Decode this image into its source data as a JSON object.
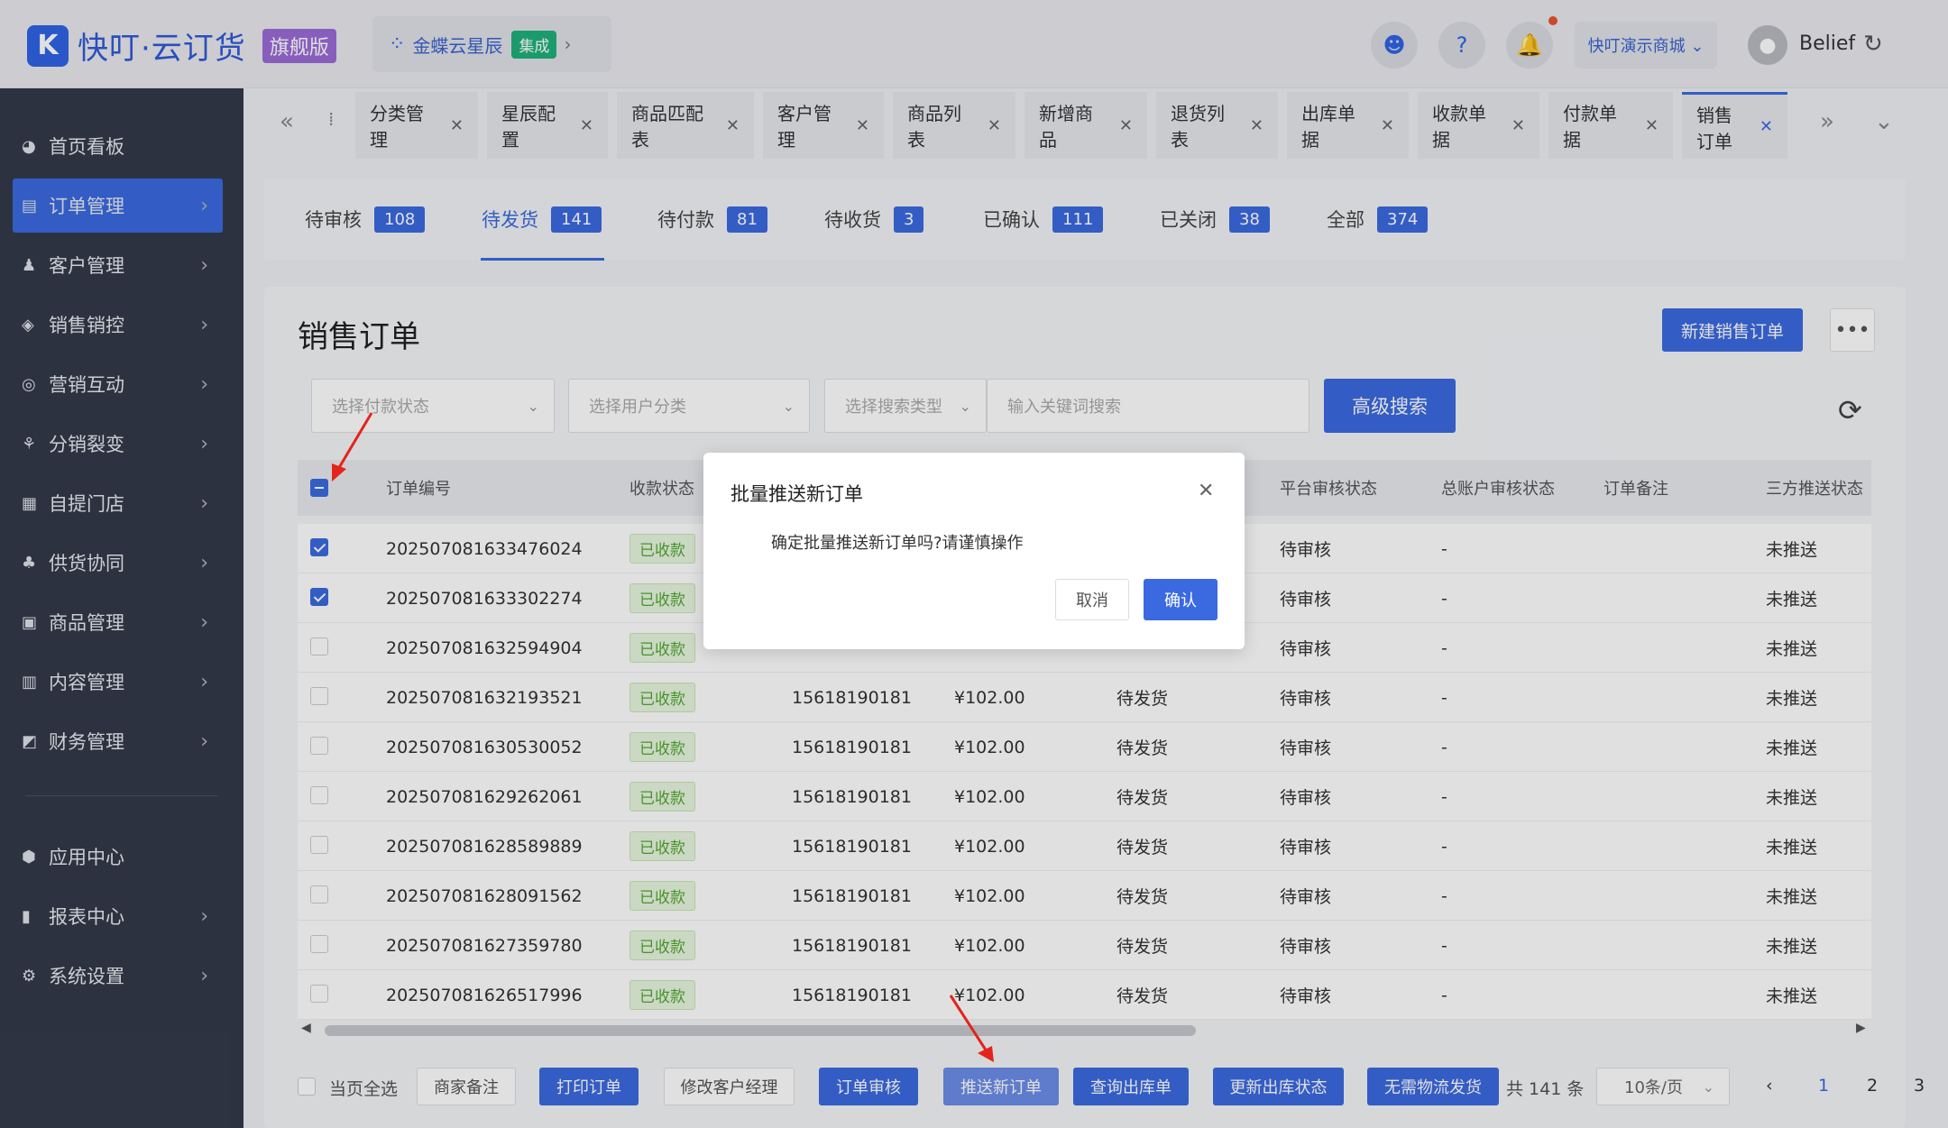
{
  "brand": {
    "logo_glyph": "K",
    "name": "快叮·云订货",
    "badge": "旗舰版"
  },
  "integration": {
    "dots": "⁘",
    "name": "金蝶云星辰",
    "badge": "集成",
    "chevron": "›"
  },
  "header": {
    "store": "快叮演示商城 ⌄",
    "user": "Belief",
    "refresh": "↻",
    "avatar": "●"
  },
  "top_icons": {
    "support": "☻",
    "help": "?",
    "bell": "🔔"
  },
  "sidebar": {
    "items": [
      {
        "icon": "◕",
        "label": "首页看板",
        "chevron": ""
      },
      {
        "icon": "▤",
        "label": "订单管理",
        "chevron": "›"
      },
      {
        "icon": "♟",
        "label": "客户管理",
        "chevron": "›"
      },
      {
        "icon": "◈",
        "label": "销售销控",
        "chevron": "›"
      },
      {
        "icon": "◎",
        "label": "营销互动",
        "chevron": "›"
      },
      {
        "icon": "⚘",
        "label": "分销裂变",
        "chevron": "›"
      },
      {
        "icon": "▦",
        "label": "自提门店",
        "chevron": "›"
      },
      {
        "icon": "♣",
        "label": "供货协同",
        "chevron": "›"
      },
      {
        "icon": "▣",
        "label": "商品管理",
        "chevron": "›"
      },
      {
        "icon": "▥",
        "label": "内容管理",
        "chevron": "›"
      },
      {
        "icon": "◩",
        "label": "财务管理",
        "chevron": "›"
      }
    ],
    "bottom_items": [
      {
        "icon": "⬢",
        "label": "应用中心",
        "chevron": ""
      },
      {
        "icon": "▮",
        "label": "报表中心",
        "chevron": "›"
      },
      {
        "icon": "⚙",
        "label": "系统设置",
        "chevron": "›"
      }
    ]
  },
  "tabs": {
    "prev": "«",
    "sep": "⁞",
    "next": "»",
    "menu": "⌄",
    "close": "✕",
    "items": [
      "分类管理",
      "星辰配置",
      "商品匹配表",
      "客户管理",
      "商品列表",
      "新增商品",
      "退货列表",
      "出库单据",
      "收款单据",
      "付款单据",
      "销售订单"
    ]
  },
  "status_tabs": [
    {
      "label": "待审核",
      "count": "108"
    },
    {
      "label": "待发货",
      "count": "141"
    },
    {
      "label": "待付款",
      "count": "81"
    },
    {
      "label": "待收货",
      "count": "3"
    },
    {
      "label": "已确认",
      "count": "111"
    },
    {
      "label": "已关闭",
      "count": "38"
    },
    {
      "label": "全部",
      "count": "374"
    }
  ],
  "page": {
    "title": "销售订单",
    "new_button": "新建销售订单",
    "more": "•••"
  },
  "filters": {
    "payment_status": "选择付款状态",
    "user_category": "选择用户分类",
    "search_type": "选择搜索类型",
    "keyword_placeholder": "输入关键词搜索",
    "advanced": "高级搜索",
    "chevron": "⌄",
    "refresh": "⟳"
  },
  "table": {
    "headers": [
      "订单编号",
      "收款状态",
      "平台审核状态",
      "总账户审核状态",
      "订单备注",
      "三方推送状态"
    ],
    "rows": [
      {
        "id": "202507081633476024",
        "pay": "已收款",
        "phone": "",
        "amount": "",
        "ship": "",
        "audit": "待审核",
        "acct": "-",
        "push": "未推送"
      },
      {
        "id": "202507081633302274",
        "pay": "已收款",
        "phone": "",
        "amount": "",
        "ship": "",
        "audit": "待审核",
        "acct": "-",
        "push": "未推送"
      },
      {
        "id": "202507081632594904",
        "pay": "已收款",
        "phone": "",
        "amount": "",
        "ship": "",
        "audit": "待审核",
        "acct": "-",
        "push": "未推送"
      },
      {
        "id": "202507081632193521",
        "pay": "已收款",
        "phone": "15618190181",
        "amount": "¥102.00",
        "ship": "待发货",
        "audit": "待审核",
        "acct": "-",
        "push": "未推送"
      },
      {
        "id": "202507081630530052",
        "pay": "已收款",
        "phone": "15618190181",
        "amount": "¥102.00",
        "ship": "待发货",
        "audit": "待审核",
        "acct": "-",
        "push": "未推送"
      },
      {
        "id": "202507081629262061",
        "pay": "已收款",
        "phone": "15618190181",
        "amount": "¥102.00",
        "ship": "待发货",
        "audit": "待审核",
        "acct": "-",
        "push": "未推送"
      },
      {
        "id": "202507081628589889",
        "pay": "已收款",
        "phone": "15618190181",
        "amount": "¥102.00",
        "ship": "待发货",
        "audit": "待审核",
        "acct": "-",
        "push": "未推送"
      },
      {
        "id": "202507081628091562",
        "pay": "已收款",
        "phone": "15618190181",
        "amount": "¥102.00",
        "ship": "待发货",
        "audit": "待审核",
        "acct": "-",
        "push": "未推送"
      },
      {
        "id": "202507081627359780",
        "pay": "已收款",
        "phone": "15618190181",
        "amount": "¥102.00",
        "ship": "待发货",
        "audit": "待审核",
        "acct": "-",
        "push": "未推送"
      },
      {
        "id": "202507081626517996",
        "pay": "已收款",
        "phone": "15618190181",
        "amount": "¥102.00",
        "ship": "待发货",
        "audit": "待审核",
        "acct": "-",
        "push": "未推送"
      }
    ],
    "scroll_left": "◀",
    "scroll_right": "▶"
  },
  "footer": {
    "select_page": "当页全选",
    "merchant_note": "商家备注",
    "print": "打印订单",
    "change_manager": "修改客户经理",
    "audit": "订单审核",
    "push": "推送新订单",
    "query_out": "查询出库单",
    "update_out": "更新出库状态",
    "no_logistics": "无需物流发货",
    "total": "共 141 条",
    "page_size": "10条/页",
    "prev": "‹",
    "pages": [
      "1",
      "2",
      "3"
    ]
  },
  "modal": {
    "title": "批量推送新订单",
    "close": "✕",
    "message": "确定批量推送新订单吗?请谨慎操作",
    "cancel": "取消",
    "confirm": "确认"
  },
  "colors": {
    "primary": "#3b6ae0",
    "sidebar": "#343a4a",
    "paid_green": "#52a832",
    "annotation_red": "#e5231b"
  }
}
